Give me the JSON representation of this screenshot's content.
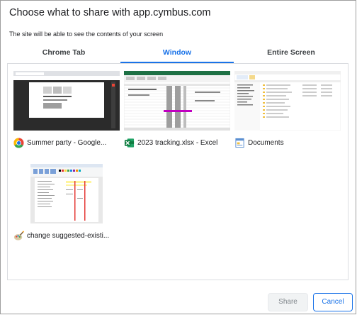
{
  "dialog": {
    "title": "Choose what to share with app.cymbus.com",
    "subtitle": "The site will be able to see the contents of your screen"
  },
  "tabs": [
    {
      "label": "Chrome Tab",
      "active": false
    },
    {
      "label": "Window",
      "active": true
    },
    {
      "label": "Entire Screen",
      "active": false
    }
  ],
  "windows": [
    {
      "label": "Summer party - Google...",
      "icon": "chrome-icon"
    },
    {
      "label": "2023 tracking.xlsx - Excel",
      "icon": "excel-icon"
    },
    {
      "label": "Documents",
      "icon": "file-explorer-icon"
    },
    {
      "label": "change suggested-existi...",
      "icon": "paint-icon"
    }
  ],
  "buttons": {
    "share": "Share",
    "cancel": "Cancel"
  },
  "colors": {
    "accent": "#1a73e8",
    "border": "#dadce0"
  }
}
